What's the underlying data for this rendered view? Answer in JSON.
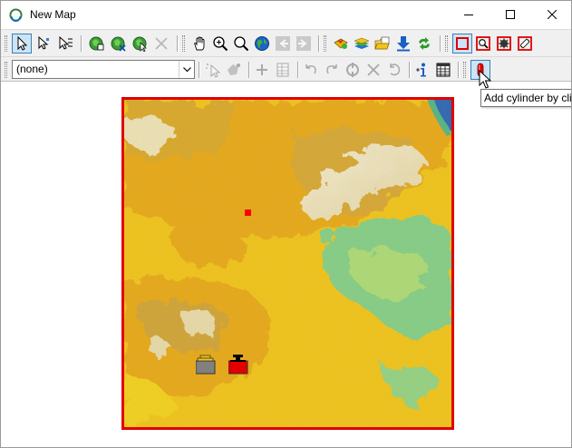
{
  "window": {
    "title": "New Map",
    "controls": {
      "minimize": "minimize-icon",
      "maximize": "maximize-icon",
      "close": "close-icon"
    }
  },
  "toolbar_row1": {
    "groups": [
      [
        "select-arrow-icon",
        "select-vertex-icon",
        "select-multiple-icon"
      ],
      [
        "add-layer-icon",
        "remove-layer-icon",
        "layer-properties-icon",
        "delete-icon"
      ],
      [
        "pan-hand-icon",
        "zoom-in-icon",
        "zoom-out-icon",
        "full-extent-globe-icon",
        "back-arrow-icon",
        "forward-arrow-icon"
      ],
      [
        "add-shape-icon",
        "layers-stack-icon",
        "open-folder-icon",
        "download-arrow-icon",
        "refresh-arrows-icon"
      ],
      [
        "rectangle-selection-icon",
        "zoom-rectangle-icon",
        "gear-selection-icon",
        "clear-selection-icon"
      ]
    ]
  },
  "toolbar_row2": {
    "layer_select": {
      "value": "(none)"
    },
    "groups": [
      [
        "edit-pointer-icon",
        "edit-shape-icon"
      ],
      [
        "add-vertex-icon",
        "table-edit-icon"
      ],
      [
        "undo-icon",
        "redo-icon",
        "snap-icon",
        "cancel-edit-icon",
        "reset-icon"
      ],
      [
        "identify-info-icon",
        "attribute-table-icon"
      ],
      [
        "add-cylinder-icon"
      ]
    ]
  },
  "tooltip": {
    "text": "Add cylinder by cli"
  },
  "map": {
    "colors": {
      "frame": "#e10000",
      "lowland": "#f2c418",
      "midland": "#e8a716",
      "hills": "#d4a12c",
      "valley": "#7dcf8e",
      "snow": "#f2ecd5",
      "water": "#1f5fbf"
    }
  }
}
